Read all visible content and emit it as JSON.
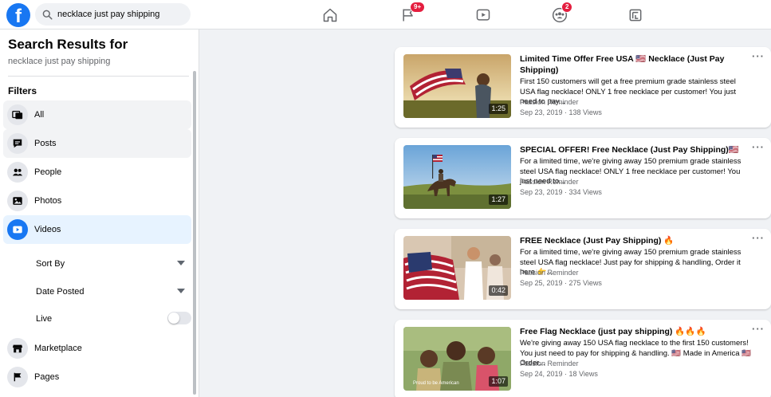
{
  "topbar": {
    "search_value": "necklace just pay shipping",
    "nav": [
      {
        "name": "home"
      },
      {
        "name": "pages",
        "badge": "9+"
      },
      {
        "name": "watch"
      },
      {
        "name": "groups",
        "badge": "2"
      },
      {
        "name": "gaming"
      }
    ]
  },
  "sidebar": {
    "title": "Search Results for",
    "query": "necklace just pay shipping",
    "filters_heading": "Filters",
    "filters": [
      {
        "label": "All",
        "icon": "all-results-icon"
      },
      {
        "label": "Posts",
        "icon": "posts-icon"
      },
      {
        "label": "People",
        "icon": "people-icon"
      },
      {
        "label": "Photos",
        "icon": "photos-icon"
      },
      {
        "label": "Videos",
        "icon": "videos-icon",
        "active": true
      }
    ],
    "sub_filters": {
      "sort_by": "Sort By",
      "date_posted": "Date Posted",
      "live": "Live",
      "live_on": false
    },
    "more_filters": [
      {
        "label": "Marketplace",
        "icon": "marketplace-icon"
      },
      {
        "label": "Pages",
        "icon": "pages-flag-icon"
      }
    ]
  },
  "results": [
    {
      "title": "Limited Time Offer Free USA 🇺🇸 Necklace (Just Pay Shipping)",
      "description": "First 150 customers will get a free premium grade stainless steel USA flag necklace! ONLY 1 free necklace per customer! You just need to pay...",
      "page": "Passion Reminder",
      "meta": "Sep 23, 2019 · 138 Views",
      "duration": "1:25"
    },
    {
      "title": "SPECIAL OFFER! Free Necklace (Just Pay Shipping)🇺🇸",
      "description": "For a limited time, we're giving away 150 premium grade stainless steel USA flag necklace! ONLY 1 free necklace per customer! You just need to...",
      "page": "Passion Reminder",
      "meta": "Sep 23, 2019 · 334 Views",
      "duration": "1:27"
    },
    {
      "title": "FREE Necklace (Just Pay Shipping) 🔥",
      "description": "For a limited time, we're giving away 150 premium grade stainless steel USA flag necklace! Just pay for shipping & handling, Order it here 👉...",
      "page": "Passion Reminder",
      "meta": "Sep 25, 2019 · 275 Views",
      "duration": "0:42"
    },
    {
      "title": "Free Flag Necklace (just pay shipping) 🔥🔥🔥",
      "description": "We're giving away 150 USA flag necklace to the first 150 customers! You just need to pay for shipping & handling. 🇺🇸 Made in America 🇺🇸 Order...",
      "page": "Passion Reminder",
      "meta": "Sep 24, 2019 · 18 Views",
      "duration": "1:07",
      "thumb_caption": "Proud to be American"
    }
  ],
  "colors": {
    "brand": "#1877f2",
    "badge": "#e41e3f",
    "active_filter_bg": "#e7f3ff"
  }
}
